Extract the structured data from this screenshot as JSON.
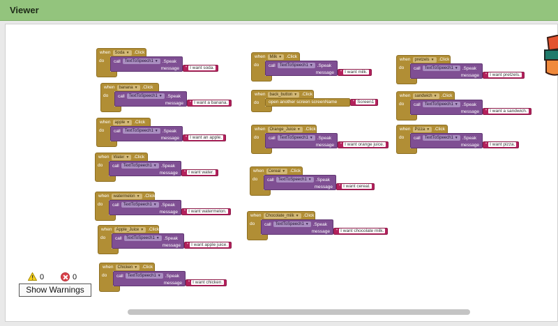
{
  "viewer": {
    "title": "Viewer"
  },
  "colors": {
    "header": "#93c47d",
    "event": "#b18e35",
    "call": "#7f4f93",
    "text": "#b3215c"
  },
  "keywords": {
    "when": "when",
    "click": ".Click",
    "do": "do",
    "call": "call",
    "speak": ".Speak",
    "message": "message"
  },
  "blocks": [
    {
      "component": "Soda",
      "tts": "TextToSpeech1",
      "message": "I want soda."
    },
    {
      "component": "banana",
      "tts": "TextToSpeech1",
      "message": "I want a banana."
    },
    {
      "component": "apple",
      "tts": "TextToSpeech1",
      "message": "I want an apple."
    },
    {
      "component": "Water",
      "tts": "TextToSpeech1",
      "message": "I want water."
    },
    {
      "component": "watermelon",
      "tts": "TextToSpeech1",
      "message": "I want watermelon."
    },
    {
      "component": "Apple_Juice",
      "tts": "TextToSpeech1",
      "message": "I want apple juice."
    },
    {
      "component": "Chicken",
      "tts": "TextToSpeech1",
      "message": "I want chicken."
    },
    {
      "component": "Milk",
      "tts": "TextToSpeech1",
      "message": "I want milk."
    },
    {
      "component": "Orange_Juice",
      "tts": "TextToSpeech1",
      "message": "I want orange juice."
    },
    {
      "component": "Cereal",
      "tts": "TextToSpeech1",
      "message": "I want cereal."
    },
    {
      "component": "Chocolate_milk",
      "tts": "TextToSpeech1",
      "message": "I want chocolate milk."
    },
    {
      "component": "pretzels",
      "tts": "TextToSpeech1",
      "message": "I want pretzels."
    },
    {
      "component": "sandwich",
      "tts": "TextToSpeech1",
      "message": "I want a sandwich."
    },
    {
      "component": "Pizza",
      "tts": "TextToSpeech1",
      "message": "I want pizza."
    }
  ],
  "back_block": {
    "component": "back_button",
    "action": "open another screen  screenName",
    "screen": "Screen1"
  },
  "warnings": {
    "warning_count": "0",
    "error_count": "0",
    "show_warnings_label": "Show Warnings"
  }
}
